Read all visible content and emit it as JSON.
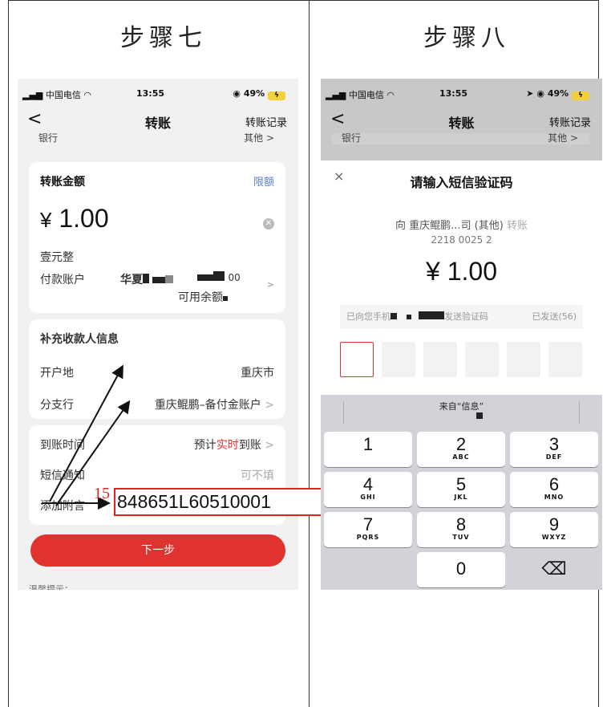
{
  "steps": {
    "left": "步骤七",
    "right": "步骤八"
  },
  "status": {
    "carrier": "中国电信",
    "time": "13:55",
    "battery": "49%"
  },
  "nav": {
    "back": "<",
    "title": "转账",
    "right": "转账记录"
  },
  "peek": {
    "left": "银行",
    "right": "其他 >"
  },
  "amount_card": {
    "header": "转账金额",
    "limit_link": "限额",
    "currency": "¥",
    "amount": "1.00",
    "amount_words": "壹元整",
    "payer_label": "付款账户",
    "payer_bank": "华夏",
    "payer_tail": "00",
    "balance_label": "可用余额",
    "chevron": ">"
  },
  "payee_card": {
    "header": "补充收款人信息",
    "region_label": "开户地",
    "region_value": "重庆市",
    "branch_label": "分支行",
    "branch_value": "重庆鲲鹏–备付金账户",
    "chevron": ">"
  },
  "options_card": {
    "arrival_label": "到账时间",
    "arrival_prefix": "预计",
    "arrival_red": "实时",
    "arrival_suffix": "到账",
    "sms_label": "短信通知",
    "sms_value": "可不填",
    "remark_label": "添加附言",
    "chevron": ">"
  },
  "next_button": "下一步",
  "hint": "温馨提示：",
  "annotation": {
    "prefix": "15",
    "account": "848651L60510001"
  },
  "sms_sheet": {
    "close": "×",
    "title": "请输入短信验证码",
    "to_prefix": "向 ",
    "to_name": "重庆鲲鹏...司 (其他)",
    "to_suffix": " 转账",
    "account": "2218 0025 2",
    "amount": "¥ 1.00",
    "sent_to": "已向您手机",
    "sent_suffix": "发送验证码",
    "resend": "已发送(56)"
  },
  "keyboard": {
    "suggestion": "来自“信息”",
    "keys": [
      {
        "n": "1",
        "l": ""
      },
      {
        "n": "2",
        "l": "ABC"
      },
      {
        "n": "3",
        "l": "DEF"
      },
      {
        "n": "4",
        "l": "GHI"
      },
      {
        "n": "5",
        "l": "JKL"
      },
      {
        "n": "6",
        "l": "MNO"
      },
      {
        "n": "7",
        "l": "PQRS"
      },
      {
        "n": "8",
        "l": "TUV"
      },
      {
        "n": "9",
        "l": "WXYZ"
      },
      {
        "n": "0",
        "l": ""
      }
    ],
    "delete": "⌫"
  }
}
